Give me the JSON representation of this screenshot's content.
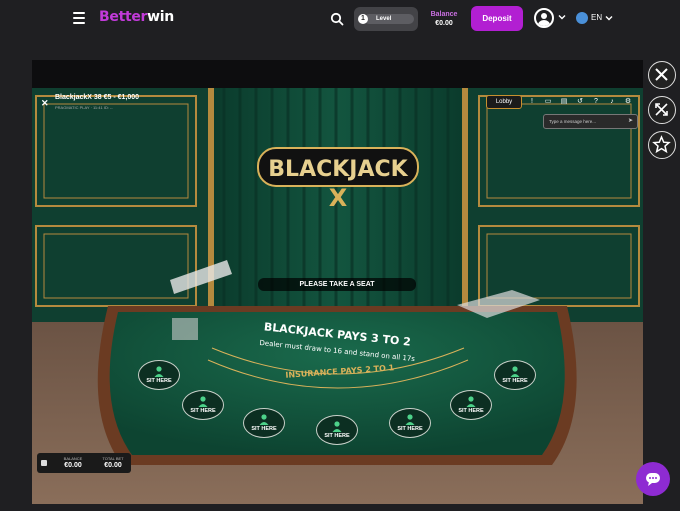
{
  "header": {
    "logo": {
      "part1": "Better",
      "part2": "win"
    },
    "level_label": "Level",
    "level_number": "1",
    "balance_label": "Balance",
    "balance_value": "€0.00",
    "deposit_label": "Deposit",
    "language": "EN"
  },
  "game": {
    "title": "BlackjackX 38 €5 - €1,000",
    "provider": "PRAGMATIC PLAY · 11:41 ID: --",
    "lobby_label": "Lobby",
    "chat_placeholder": "Type a message here...",
    "logo_main": "BLACKJACK",
    "logo_x": "X",
    "take_seat": "PLEASE TAKE A SEAT",
    "table_text": {
      "line1": "BLACKJACK PAYS 3 TO 2",
      "line2": "Dealer must draw to 16 and stand on all 17s",
      "line3": "INSURANCE PAYS 2 TO 1"
    },
    "seat_label": "SIT HERE",
    "seat_count": 7,
    "footer": {
      "balance_label": "BALANCE",
      "balance_value": "€0.00",
      "total_bet_label": "TOTAL BET",
      "total_bet_value": "€0.00"
    }
  },
  "side_buttons": [
    "close-icon",
    "expand-icon",
    "star-icon"
  ],
  "colors": {
    "brand_purple": "#b21fd2",
    "felt_green": "#0f4a36",
    "gold": "#d9b25a",
    "page_bg": "#1f1f22"
  }
}
